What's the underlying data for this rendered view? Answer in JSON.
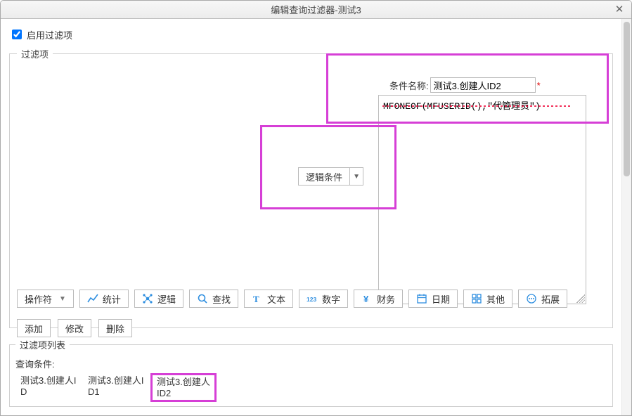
{
  "window": {
    "title": "编辑查询过滤器-测试3"
  },
  "enable_filter_label": "启用过滤项",
  "enable_filter_checked": true,
  "filter_group_legend": "过滤项",
  "condition_name": {
    "label": "条件名称:",
    "value": "测试3.创建人ID2"
  },
  "expression": "MFONEOF(MFUSERID(),\"代管理员\")",
  "logic_combo": {
    "label": "逻辑条件"
  },
  "toolbar": {
    "operator": "操作符",
    "stats": "统计",
    "logic": "逻辑",
    "search": "查找",
    "text": "文本",
    "number": "数字",
    "finance": "财务",
    "date": "日期",
    "other": "其他",
    "extend": "拓展"
  },
  "actions": {
    "add": "添加",
    "modify": "修改",
    "delete": "删除"
  },
  "list_group_legend": "过滤项列表",
  "query_label": "查询条件:",
  "conditions": [
    {
      "label": "测试3.创建人ID"
    },
    {
      "label": "测试3.创建人ID1"
    },
    {
      "label": "测试3.创建人ID2"
    }
  ]
}
